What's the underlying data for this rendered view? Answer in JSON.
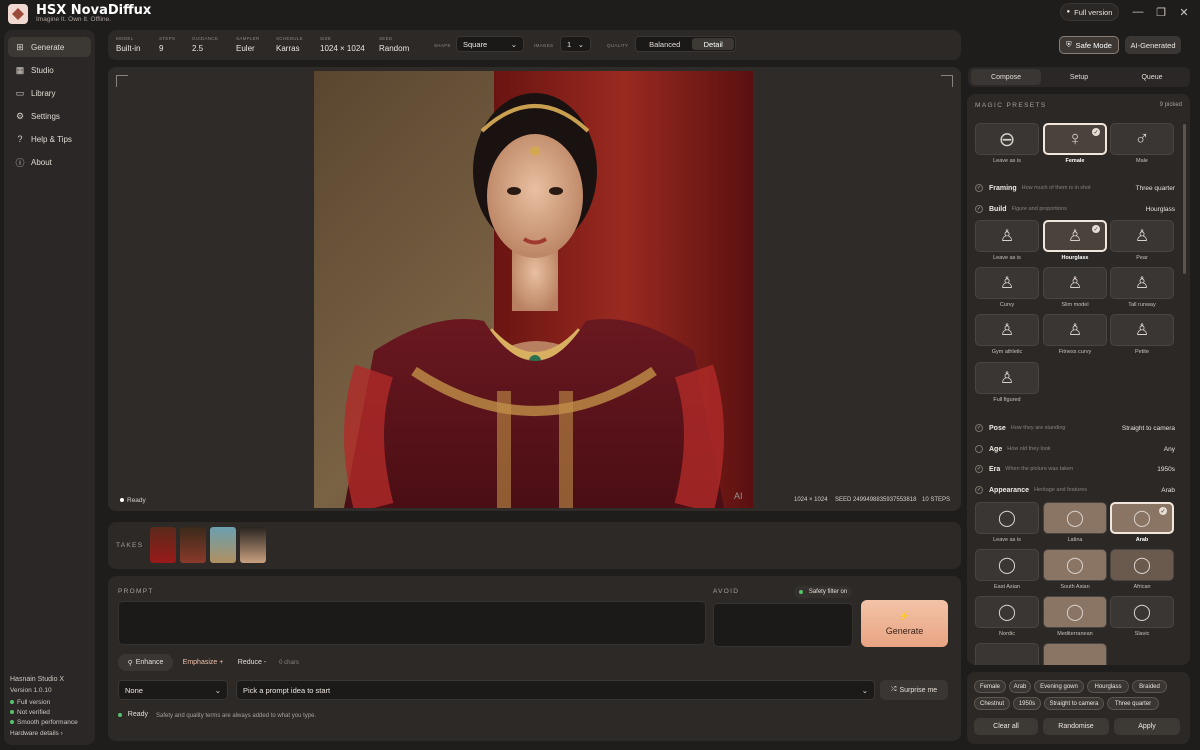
{
  "app": {
    "title": "HSX NovaDiffux",
    "tagline": "Imagine It. Own It. Offline.",
    "full_version": "Full version",
    "minimize": "—",
    "maximize": "❐",
    "close": "✕"
  },
  "nav": [
    {
      "label": "Generate",
      "icon": "generate-icon",
      "active": true
    },
    {
      "label": "Studio",
      "icon": "grid-icon"
    },
    {
      "label": "Library",
      "icon": "folder-icon"
    },
    {
      "label": "Settings",
      "icon": "gear-icon"
    },
    {
      "label": "Help & Tips",
      "icon": "question-icon"
    },
    {
      "label": "About",
      "icon": "info-icon"
    }
  ],
  "sidebar_footer": {
    "studio": "Hasnain Studio X",
    "version": "Version 1.0.10",
    "status": [
      "Full version",
      "Not verified",
      "Smooth performance"
    ],
    "hardware": "Hardware details ›"
  },
  "params": [
    {
      "key": "MODEL",
      "value": "Built-in"
    },
    {
      "key": "STEPS",
      "value": "9"
    },
    {
      "key": "GUIDANCE",
      "value": "2.5"
    },
    {
      "key": "SAMPLER",
      "value": "Euler"
    },
    {
      "key": "SCHEDULE",
      "value": "Karras"
    },
    {
      "key": "SIZE",
      "value": "1024 × 1024"
    },
    {
      "key": "SEED",
      "value": "Random"
    }
  ],
  "shape": {
    "label": "SHAPE",
    "value": "Square"
  },
  "images": {
    "label": "IMAGES",
    "value": "1"
  },
  "quality": {
    "label": "QUALITY",
    "options": [
      "Balanced",
      "Detail"
    ],
    "active": "Detail"
  },
  "safe_mode": "Safe Mode",
  "ai_generated": "AI-Generated",
  "stage": {
    "status": "Ready",
    "size": "1024 × 1024",
    "seed": "SEED 2499498835937553818",
    "steps": "10 STEPS",
    "watermark": "AI"
  },
  "takes": {
    "label": "TAKES"
  },
  "prompt": {
    "label": "PROMPT",
    "value": "",
    "avoid_label": "AVOID",
    "safety": "Safety filter on",
    "generate": "Generate",
    "enhance": "Enhance",
    "emphasize": "Emphasize +",
    "reduce": "Reduce -",
    "chars": "0 chars",
    "style_value": "None",
    "idea_placeholder": "Pick a prompt idea to start",
    "surprise": "Surprise me",
    "status": "Ready",
    "note": "Safety and quality terms are always added to what you type."
  },
  "right_tabs": {
    "items": [
      "Compose",
      "Setup",
      "Queue"
    ],
    "active": "Compose"
  },
  "presets": {
    "title": "MAGIC PRESETS",
    "picked": "9 picked",
    "gender": [
      {
        "label": "Leave as is",
        "icon": "circle-slash-icon"
      },
      {
        "label": "Female",
        "icon": "female-icon",
        "selected": true
      },
      {
        "label": "Male",
        "icon": "male-icon"
      }
    ],
    "framing": {
      "name": "Framing",
      "desc": "How much of them is in shot",
      "value": "Three quarter"
    },
    "build": {
      "name": "Build",
      "desc": "Figure and proportions",
      "value": "Hourglass"
    },
    "build_tiles": [
      {
        "label": "Leave as is"
      },
      {
        "label": "Hourglass",
        "selected": true
      },
      {
        "label": "Pear"
      },
      {
        "label": "Curvy"
      },
      {
        "label": "Slim model"
      },
      {
        "label": "Tall runway"
      },
      {
        "label": "Gym athletic"
      },
      {
        "label": "Fitness curvy"
      },
      {
        "label": "Petite"
      },
      {
        "label": "Full figured"
      }
    ],
    "pose": {
      "name": "Pose",
      "desc": "How they are standing",
      "value": "Straight to camera"
    },
    "age": {
      "name": "Age",
      "desc": "How old they look",
      "value": "Any"
    },
    "era": {
      "name": "Era",
      "desc": "When the picture was taken",
      "value": "1950s"
    },
    "appearance": {
      "name": "Appearance",
      "desc": "Heritage and features",
      "value": "Arab"
    },
    "appearance_tiles": [
      {
        "label": "Leave as is"
      },
      {
        "label": "Latina",
        "warm": true
      },
      {
        "label": "Arab",
        "selected": true,
        "warm": true
      },
      {
        "label": "East Asian"
      },
      {
        "label": "South Asian",
        "warm": true
      },
      {
        "label": "African",
        "warm2": true
      },
      {
        "label": "Nordic"
      },
      {
        "label": "Mediterranean",
        "warm": true
      },
      {
        "label": "Slavic"
      }
    ]
  },
  "tags": [
    "Female",
    "Arab",
    "Evening gown",
    "Hourglass",
    "Braided",
    "Chestnut",
    "1950s",
    "Straight to camera",
    "Three quarter"
  ],
  "tag_actions": [
    "Clear all",
    "Randomise",
    "Apply"
  ],
  "colors": {
    "accent": "#e8a483",
    "bg": "#1f1d1c",
    "panel": "#2c2927",
    "ready": "#56c26a"
  }
}
